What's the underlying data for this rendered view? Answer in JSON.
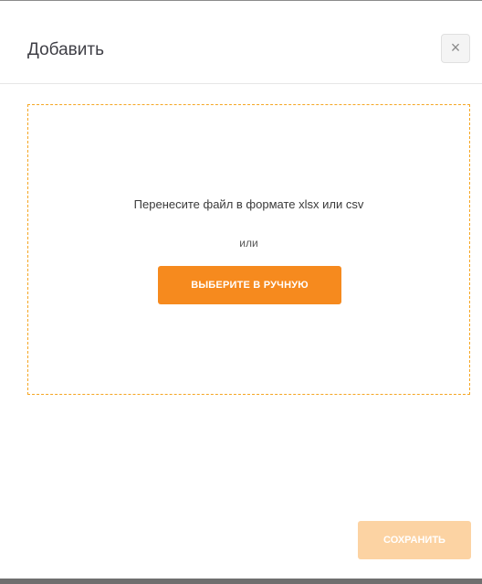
{
  "dialog": {
    "title": "Добавить",
    "close_label": "×"
  },
  "dropzone": {
    "instruction": "Перенесите файл в формате xlsx или csv",
    "or_text": "или",
    "choose_button_label": "ВЫБЕРИТЕ В РУЧНУЮ"
  },
  "footer": {
    "save_button_label": "СОХРАНИТЬ",
    "save_button_state": "disabled"
  },
  "colors": {
    "accent": "#f68a1e",
    "accent_disabled": "#fcd3a3",
    "dropzone_border": "#f5a623"
  }
}
